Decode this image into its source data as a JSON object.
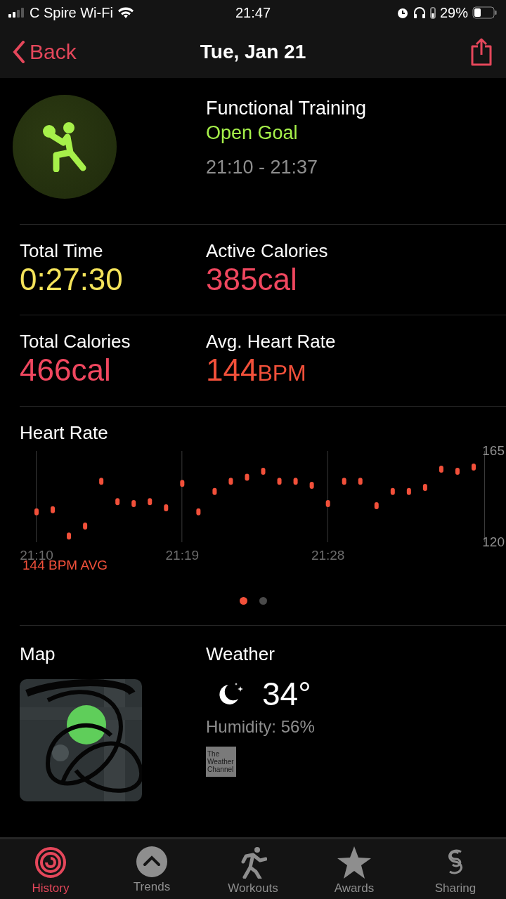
{
  "status_bar": {
    "carrier": "C Spire Wi-Fi",
    "time": "21:47",
    "battery": "29%"
  },
  "nav": {
    "back": "Back",
    "title": "Tue, Jan 21"
  },
  "workout": {
    "name": "Functional Training",
    "goal": "Open Goal",
    "time_range": "21:10 - 21:37"
  },
  "stats": [
    {
      "label": "Total Time",
      "value": "0:27:30",
      "color": "#f4e35a"
    },
    {
      "label": "Active Calories",
      "value": "385cal",
      "color": "#f0475f"
    },
    {
      "label": "Total Calories",
      "value": "466cal",
      "color": "#f0475f"
    },
    {
      "label": "Avg. Heart Rate",
      "value": "144",
      "unit": "BPM",
      "color": "#f2503a"
    }
  ],
  "heart_rate": {
    "average": "144 BPM AVG",
    "chart_data": {
      "type": "scatter",
      "title": "Heart Rate",
      "grid": true,
      "ylim": [
        120,
        165
      ],
      "yticks": [
        120,
        165
      ],
      "categories": [
        "21:10",
        null,
        null,
        null,
        null,
        null,
        null,
        null,
        null,
        "21:19",
        null,
        null,
        null,
        null,
        null,
        null,
        null,
        null,
        "21:28",
        null,
        null,
        null,
        null,
        null,
        null,
        null,
        null,
        null
      ],
      "series": [
        {
          "color": "#f2503a",
          "values": [
            135,
            136,
            123,
            128,
            150,
            140,
            139,
            140,
            137,
            149,
            135,
            145,
            150,
            152,
            155,
            150,
            150,
            148,
            139,
            150,
            150,
            138,
            145,
            145,
            147,
            156,
            155,
            157
          ]
        }
      ]
    }
  },
  "pages": [
    {
      "selected": true
    },
    {
      "selected": false
    }
  ],
  "map": {
    "title": "Map",
    "kind": "picture"
  },
  "weather": {
    "title": "Weather",
    "temperature": "34°",
    "humidity": "Humidity: 56%",
    "source": [
      "The",
      "Weather",
      "Channel"
    ]
  },
  "tabs": [
    {
      "label": "History",
      "selected": true,
      "kind": "rings"
    },
    {
      "label": "Trends",
      "selected": false,
      "kind": "trends"
    },
    {
      "label": "Workouts",
      "selected": false,
      "kind": "runner"
    },
    {
      "label": "Awards",
      "selected": false,
      "kind": "star"
    },
    {
      "label": "Sharing",
      "selected": false,
      "kind": "sharing"
    }
  ]
}
